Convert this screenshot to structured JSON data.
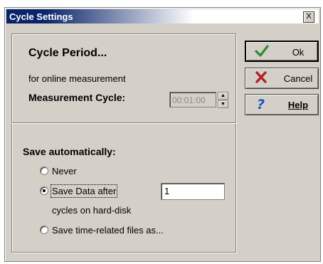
{
  "window": {
    "title": "Cycle Settings",
    "close_label": "X"
  },
  "cycle": {
    "heading": "Cycle Period...",
    "subtitle": "for online measurement",
    "measurement_label": "Measurement Cycle:",
    "measurement_value": "00:01:00"
  },
  "save": {
    "heading": "Save automatically:",
    "options": [
      {
        "label": "Never",
        "checked": false
      },
      {
        "label": "Save Data after",
        "checked": true
      },
      {
        "label": "Save time-related files as...",
        "checked": false
      }
    ],
    "count_value": "1",
    "cycles_label": "cycles on hard-disk"
  },
  "buttons": {
    "ok": "Ok",
    "cancel": "Cancel",
    "help": "Help"
  },
  "colors": {
    "title_bar": "#0a246a",
    "dialog_bg": "#d4d0c8",
    "check_green": "#2e8b2e",
    "cross_red": "#b22222",
    "help_blue": "#1f4fc0"
  }
}
